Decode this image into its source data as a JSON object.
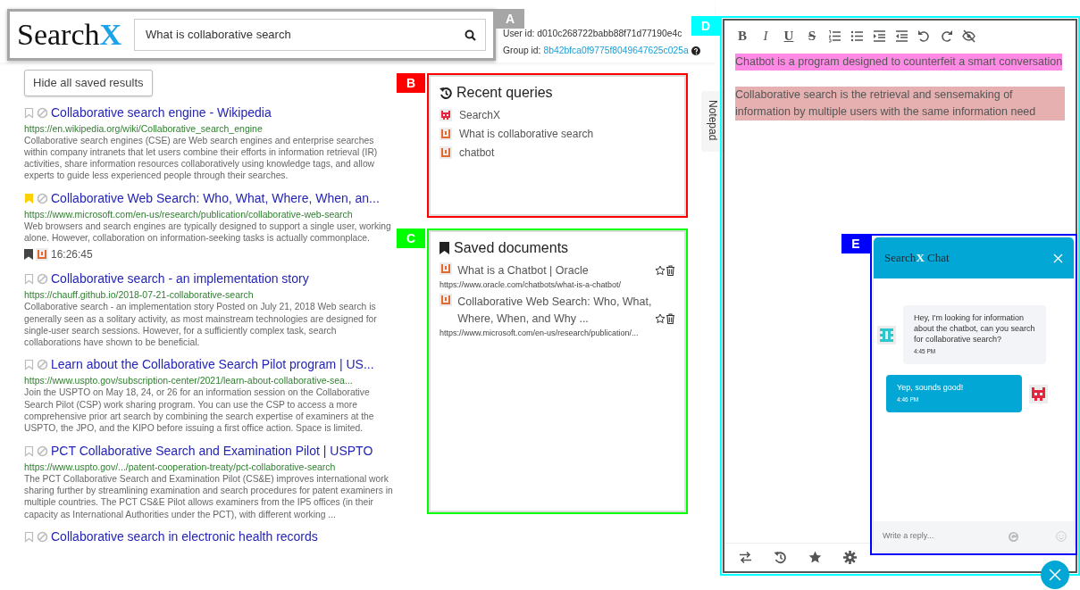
{
  "header": {
    "annotation": {
      "letter": "A",
      "color": "#a6a6a6"
    },
    "logo": {
      "text": "Search",
      "accent": "X"
    },
    "search": {
      "value": "What is collaborative search"
    },
    "user_id": {
      "label": "User id:",
      "value": "d010c268722babb88f71d77190e4c"
    },
    "group_id": {
      "label": "Group id:",
      "value": "8b42bfca0f9775f8049647625c025a"
    }
  },
  "hide_button": "Hide all saved results",
  "results": [
    {
      "bookmarked": false,
      "title": "Collaborative search engine - Wikipedia",
      "url": "https://en.wikipedia.org/wiki/Collaborative_search_engine",
      "snippet": "Collaborative search engines (CSE) are Web search engines and enterprise searches within company intranets that let users combine their efforts in information retrieval (IR) activities, share information resources collaboratively using knowledge tags, and allow experts to guide less experienced people through their searches."
    },
    {
      "bookmarked": true,
      "title": "Collaborative Web Search: Who, What, Where, When, an...",
      "url": "https://www.microsoft.com/en-us/research/publication/collaborative-web-search",
      "snippet": "Web browsers and search engines are typically designed to support a single user, working alone. However, collaboration on information-seeking tasks is actually commonplace.",
      "saved_by": {
        "color": "#e36a2f",
        "time": "16:26:45"
      }
    },
    {
      "bookmarked": false,
      "title": "Collaborative search - an implementation story",
      "url": "https://chauff.github.io/2018-07-21-collaborative-search",
      "snippet": "Collaborative search - an implementation story Posted on July 21, 2018 Web search is generally seen as a solitary activity, as most mainstream technologies are designed for single-user search sessions. However, for a sufficiently complex task, search collaborations have shown to be beneficial."
    },
    {
      "bookmarked": false,
      "title": "Learn about the Collaborative Search Pilot program | US...",
      "url": "https://www.uspto.gov/subscription-center/2021/learn-about-collaborative-sea...",
      "snippet": "Join the USPTO on May 18, 24, or 26 for an information session on the Collaborative Search Pilot (CSP) work sharing program. You can use the CSP to access a more comprehensive prior art search by combining the search expertise of examiners at the USPTO, the JPO, and the KIPO before issuing a first office action. Space is limited."
    },
    {
      "bookmarked": false,
      "title": "PCT Collaborative Search and Examination Pilot | USPTO",
      "url": "https://www.uspto.gov/.../patent-cooperation-treaty/pct-collaborative-search",
      "snippet": "The PCT Collaborative Search and Examination Pilot (CS&E) improves international work sharing further by streamlining examination and search procedures for patent examiners in multiple countries. The PCT CS&E Pilot allows examiners from the IP5 offices (in their capacity as International Authorities under the PCT), with different working ..."
    },
    {
      "bookmarked": false,
      "title": "Collaborative search in electronic health records"
    }
  ],
  "recent_queries": {
    "annotation": {
      "letter": "B",
      "color": "#ff0000"
    },
    "title": "Recent queries",
    "items": [
      {
        "color": "#e3263d",
        "query": "SearchX"
      },
      {
        "color": "#e36a2f",
        "query": "What is collaborative search"
      },
      {
        "color": "#e36a2f",
        "query": "chatbot"
      }
    ]
  },
  "saved_documents": {
    "annotation": {
      "letter": "C",
      "color": "#00ff00"
    },
    "title": "Saved documents",
    "items": [
      {
        "color": "#e36a2f",
        "title": "What is a Chatbot | Oracle",
        "url": "https://www.oracle.com/chatbots/what-is-a-chatbot/"
      },
      {
        "color": "#e36a2f",
        "title": "Collaborative Web Search: Who, What, Where, When, and Why ...",
        "url": "https://www.microsoft.com/en-us/research/publication/..."
      }
    ]
  },
  "notepad_tab": "Notepad",
  "notepad": {
    "annotation": {
      "letter": "D",
      "color": "#00ffff"
    },
    "format_buttons": [
      {
        "label": "B",
        "kind": "bold"
      },
      {
        "label": "I",
        "kind": "italic"
      },
      {
        "label": "U",
        "kind": "underline"
      },
      {
        "label": "S",
        "kind": "strike"
      }
    ],
    "notes": [
      {
        "text": "Chatbot is a program designed to counterfeit a smart conversation",
        "color": "#ff8ae6"
      },
      {
        "text": "Collaborative search is the retrieval and sensemaking of information by multiple users with the same information need",
        "color": "#e6b0b0"
      }
    ]
  },
  "chat": {
    "annotation": {
      "letter": "E",
      "color": "#0000ff"
    },
    "title": {
      "text": "Search",
      "accent": "X",
      "rest": "Chat"
    },
    "messages": [
      {
        "kind": "incoming",
        "color": "#2dc6cc",
        "text": "Hey, I'm looking for information about the chatbot, can you search for collaborative search?",
        "time": "4:45 PM"
      },
      {
        "kind": "outgoing",
        "color": "#e3263d",
        "text": "Yep, sounds good!",
        "time": "4:46 PM"
      }
    ],
    "placeholder": "Write a reply..."
  }
}
